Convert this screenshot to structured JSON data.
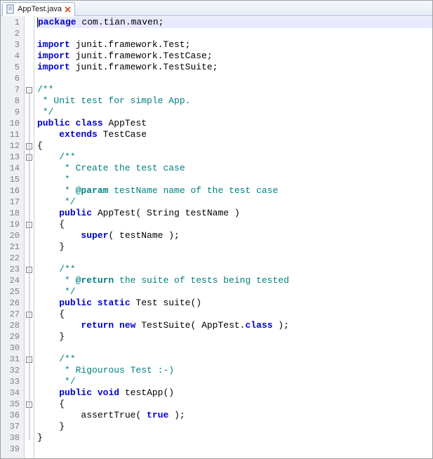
{
  "tab": {
    "filename": "AppTest.java"
  },
  "code": {
    "l1_kw": "package",
    "l1_rest": " com.tian.maven;",
    "l3_kw": "import",
    "l3_rest": " junit.framework.Test;",
    "l4_kw": "import",
    "l4_rest": " junit.framework.TestCase;",
    "l5_kw": "import",
    "l5_rest": " junit.framework.TestSuite;",
    "l7": "/**",
    "l8": " * Unit test for simple App.",
    "l9": " */",
    "l10_kw1": "public",
    "l10_kw2": "class",
    "l10_name": " AppTest",
    "l11_kw": "extends",
    "l11_rest": " TestCase",
    "l12": "{",
    "l13": "/**",
    "l14": " * Create the test case",
    "l15": " *",
    "l16a": " * ",
    "l16param": "@param",
    "l16b": " testName name of the test case",
    "l17": " */",
    "l18_kw": "public",
    "l18_name": " AppTest( String testName )",
    "l19": "{",
    "l20_kw": "super",
    "l20_rest": "( testName );",
    "l21": "}",
    "l23": "/**",
    "l24a": " * ",
    "l24param": "@return",
    "l24b": " the suite of tests being tested",
    "l25": " */",
    "l26_kw1": "public",
    "l26_kw2": "static",
    "l26_rest": " Test suite()",
    "l27": "{",
    "l28_kw1": "return",
    "l28_kw2": "new",
    "l28a": " ",
    "l28b": " TestSuite( AppTest.",
    "l28_kw3": "class",
    "l28c": " );",
    "l29": "}",
    "l31": "/**",
    "l32": " * Rigourous Test :-)",
    "l33": " */",
    "l34_kw1": "public",
    "l34_kw2": "void",
    "l34_rest": " testApp()",
    "l35": "{",
    "l36": "assertTrue( ",
    "l36_kw": "true",
    "l36b": " );",
    "l37": "}",
    "l38": "}"
  },
  "lines": 39
}
